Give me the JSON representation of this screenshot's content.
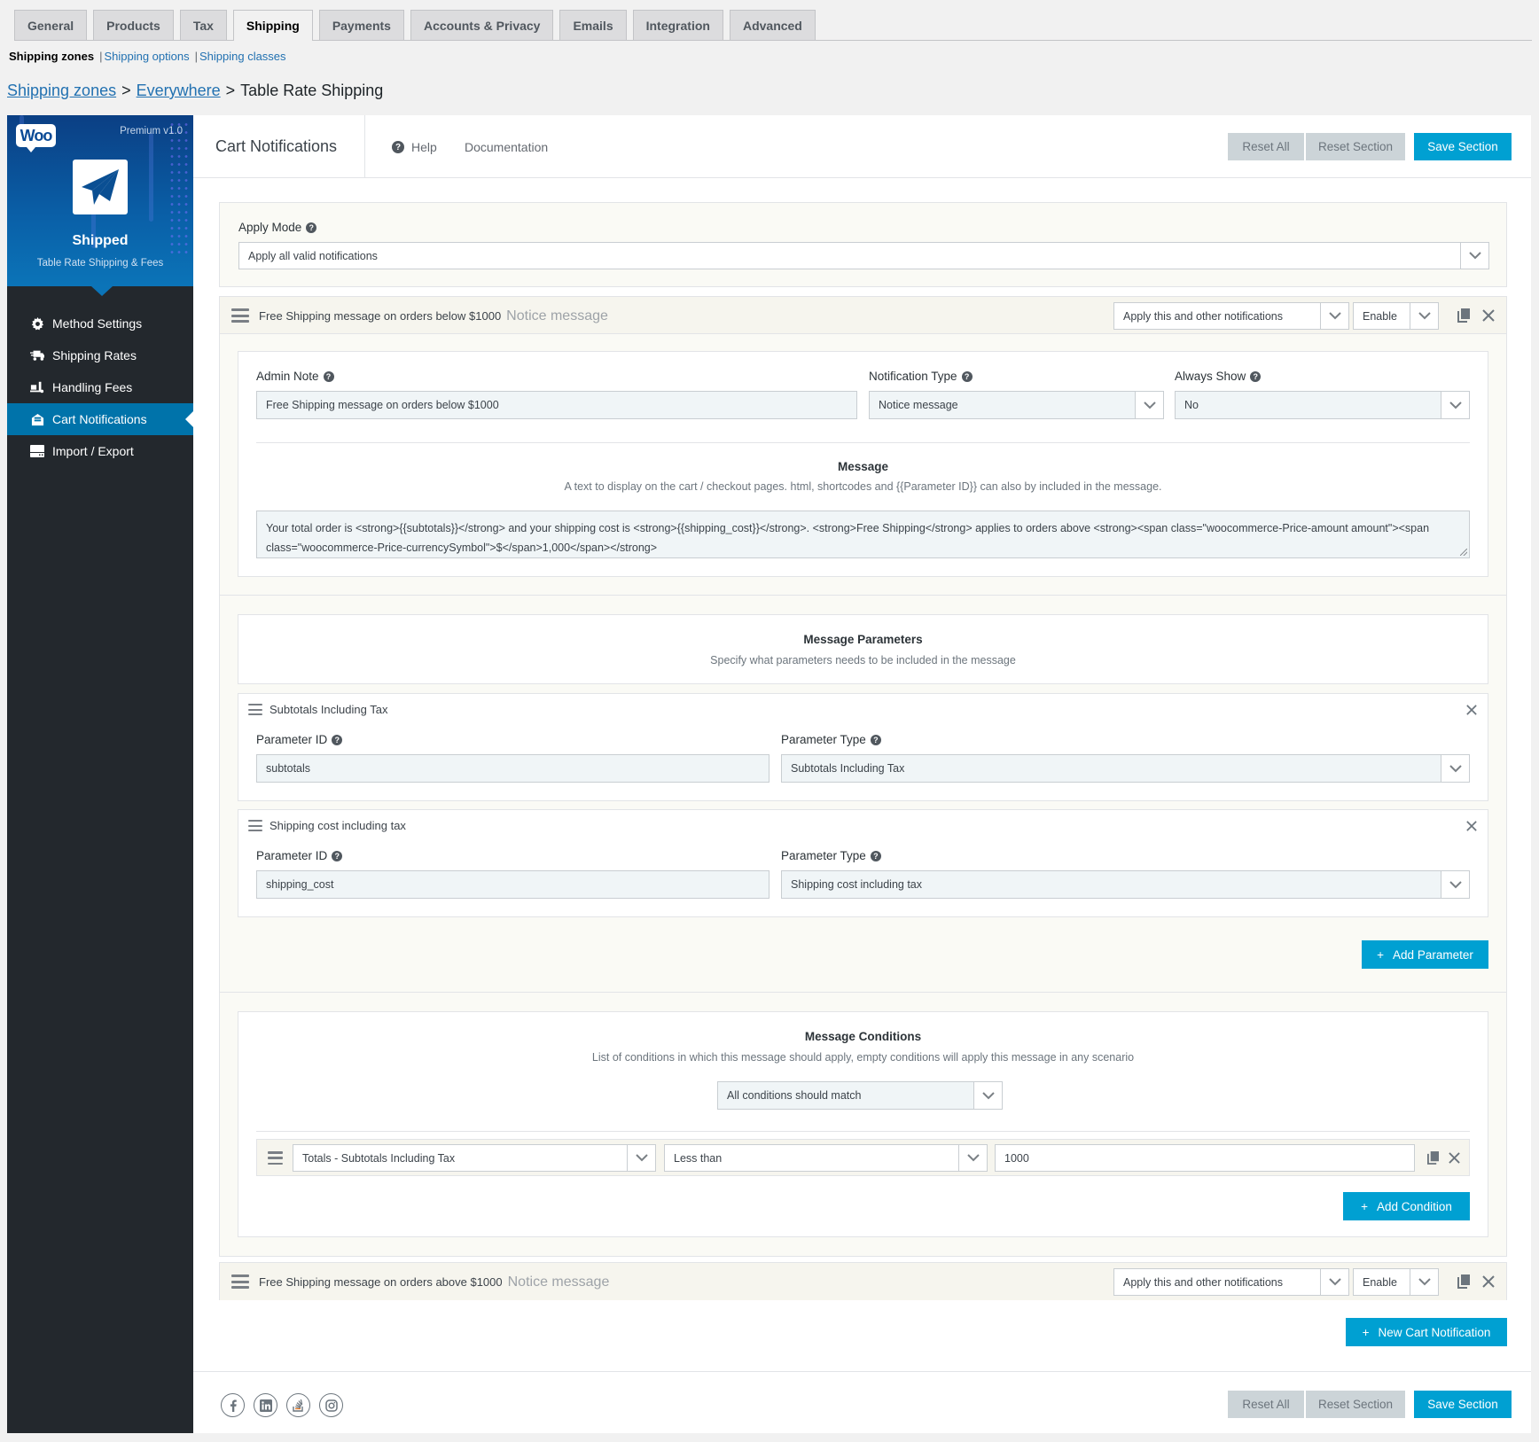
{
  "tabs": [
    {
      "label": "General",
      "active": false
    },
    {
      "label": "Products",
      "active": false
    },
    {
      "label": "Tax",
      "active": false
    },
    {
      "label": "Shipping",
      "active": true
    },
    {
      "label": "Payments",
      "active": false
    },
    {
      "label": "Accounts & Privacy",
      "active": false
    },
    {
      "label": "Emails",
      "active": false
    },
    {
      "label": "Integration",
      "active": false
    },
    {
      "label": "Advanced",
      "active": false
    }
  ],
  "subnav": {
    "current": "Shipping zones",
    "links": [
      "Shipping options",
      "Shipping classes"
    ],
    "separator": "|"
  },
  "breadcrumb": {
    "links": [
      "Shipping zones",
      "Everywhere"
    ],
    "separator": ">",
    "current": "Table Rate Shipping"
  },
  "sidebar": {
    "woo_logo": "Woo",
    "version": "Premium v1.0",
    "plugin_name": "Shipped",
    "plugin_subtitle": "Table Rate Shipping & Fees",
    "items": [
      {
        "label": "Method Settings",
        "icon": "gear-icon",
        "active": false
      },
      {
        "label": "Shipping Rates",
        "icon": "truck-icon",
        "active": false
      },
      {
        "label": "Handling Fees",
        "icon": "hand-truck-icon",
        "active": false
      },
      {
        "label": "Cart Notifications",
        "icon": "envelope-open-icon",
        "active": true
      },
      {
        "label": "Import / Export",
        "icon": "hdd-icon",
        "active": false
      }
    ]
  },
  "header": {
    "title": "Cart Notifications",
    "help_label": "Help",
    "documentation_label": "Documentation",
    "reset_all_label": "Reset All",
    "reset_section_label": "Reset Section",
    "save_section_label": "Save Section"
  },
  "apply_mode": {
    "label": "Apply Mode",
    "value": "Apply all valid notifications"
  },
  "notifications": [
    {
      "title": "Free Shipping message on orders below $1000",
      "type_label": "Notice message",
      "apply_value": "Apply this and other notifications",
      "status_value": "Enable",
      "admin_note_label": "Admin Note",
      "admin_note_value": "Free Shipping message on orders below $1000",
      "notification_type_label": "Notification Type",
      "notification_type_value": "Notice message",
      "always_show_label": "Always Show",
      "always_show_value": "No",
      "message_title": "Message",
      "message_desc": "A text to display on the cart / checkout pages. html, shortcodes and {{Parameter ID}} can also by included in the message.",
      "message_value": "Your total order is <strong>{{subtotals}}</strong> and your shipping cost is <strong>{{shipping_cost}}</strong>. <strong>Free Shipping</strong> applies to orders above <strong><span class=\"woocommerce-Price-amount amount\"><span class=\"woocommerce-Price-currencySymbol\">$</span>1,000</span></strong>",
      "params_title": "Message Parameters",
      "params_desc": "Specify what parameters needs to be included in the message",
      "parameters": [
        {
          "title": "Subtotals Including Tax",
          "id_label": "Parameter ID",
          "id_value": "subtotals",
          "type_label": "Parameter Type",
          "type_value": "Subtotals Including Tax"
        },
        {
          "title": "Shipping cost including tax",
          "id_label": "Parameter ID",
          "id_value": "shipping_cost",
          "type_label": "Parameter Type",
          "type_value": "Shipping cost including tax"
        }
      ],
      "add_parameter_label": "Add Parameter",
      "conditions_title": "Message Conditions",
      "conditions_desc": "List of conditions in which this message should apply, empty conditions will apply this message in any scenario",
      "conditions_match_value": "All conditions should match",
      "conditions": [
        {
          "field": "Totals - Subtotals Including Tax",
          "operator": "Less than",
          "value": "1000"
        }
      ],
      "add_condition_label": "Add Condition"
    },
    {
      "title": "Free Shipping message on orders above $1000",
      "type_label": "Notice message",
      "apply_value": "Apply this and other notifications",
      "status_value": "Enable"
    }
  ],
  "new_notification_label": "New Cart Notification",
  "footer": {
    "social": [
      "facebook-icon",
      "linkedin-icon",
      "stackoverflow-icon",
      "instagram-icon"
    ],
    "reset_all_label": "Reset All",
    "reset_section_label": "Reset Section",
    "save_section_label": "Save Section"
  },
  "colors": {
    "accent": "#00a0d2",
    "sidebar_bg": "#23282d",
    "sidebar_active": "#0073aa",
    "grey_button": "#ccd4d8"
  }
}
